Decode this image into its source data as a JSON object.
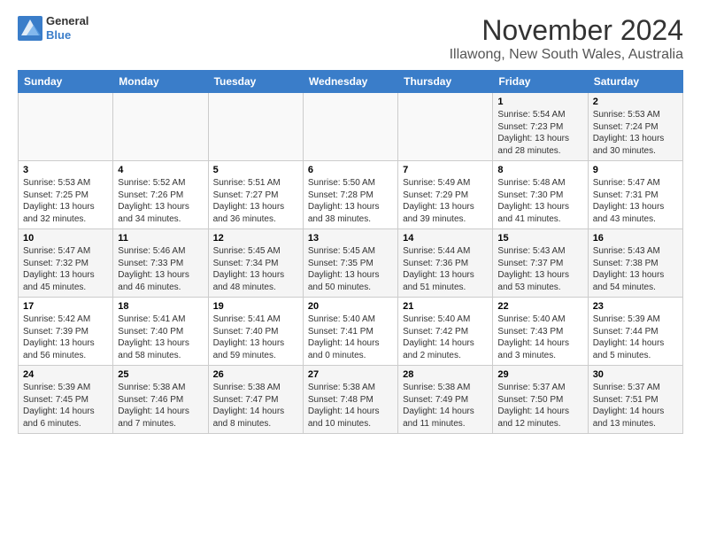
{
  "logo": {
    "line1": "General",
    "line2": "Blue"
  },
  "title": "November 2024",
  "location": "Illawong, New South Wales, Australia",
  "weekdays": [
    "Sunday",
    "Monday",
    "Tuesday",
    "Wednesday",
    "Thursday",
    "Friday",
    "Saturday"
  ],
  "weeks": [
    [
      {
        "day": "",
        "content": ""
      },
      {
        "day": "",
        "content": ""
      },
      {
        "day": "",
        "content": ""
      },
      {
        "day": "",
        "content": ""
      },
      {
        "day": "",
        "content": ""
      },
      {
        "day": "1",
        "content": "Sunrise: 5:54 AM\nSunset: 7:23 PM\nDaylight: 13 hours\nand 28 minutes."
      },
      {
        "day": "2",
        "content": "Sunrise: 5:53 AM\nSunset: 7:24 PM\nDaylight: 13 hours\nand 30 minutes."
      }
    ],
    [
      {
        "day": "3",
        "content": "Sunrise: 5:53 AM\nSunset: 7:25 PM\nDaylight: 13 hours\nand 32 minutes."
      },
      {
        "day": "4",
        "content": "Sunrise: 5:52 AM\nSunset: 7:26 PM\nDaylight: 13 hours\nand 34 minutes."
      },
      {
        "day": "5",
        "content": "Sunrise: 5:51 AM\nSunset: 7:27 PM\nDaylight: 13 hours\nand 36 minutes."
      },
      {
        "day": "6",
        "content": "Sunrise: 5:50 AM\nSunset: 7:28 PM\nDaylight: 13 hours\nand 38 minutes."
      },
      {
        "day": "7",
        "content": "Sunrise: 5:49 AM\nSunset: 7:29 PM\nDaylight: 13 hours\nand 39 minutes."
      },
      {
        "day": "8",
        "content": "Sunrise: 5:48 AM\nSunset: 7:30 PM\nDaylight: 13 hours\nand 41 minutes."
      },
      {
        "day": "9",
        "content": "Sunrise: 5:47 AM\nSunset: 7:31 PM\nDaylight: 13 hours\nand 43 minutes."
      }
    ],
    [
      {
        "day": "10",
        "content": "Sunrise: 5:47 AM\nSunset: 7:32 PM\nDaylight: 13 hours\nand 45 minutes."
      },
      {
        "day": "11",
        "content": "Sunrise: 5:46 AM\nSunset: 7:33 PM\nDaylight: 13 hours\nand 46 minutes."
      },
      {
        "day": "12",
        "content": "Sunrise: 5:45 AM\nSunset: 7:34 PM\nDaylight: 13 hours\nand 48 minutes."
      },
      {
        "day": "13",
        "content": "Sunrise: 5:45 AM\nSunset: 7:35 PM\nDaylight: 13 hours\nand 50 minutes."
      },
      {
        "day": "14",
        "content": "Sunrise: 5:44 AM\nSunset: 7:36 PM\nDaylight: 13 hours\nand 51 minutes."
      },
      {
        "day": "15",
        "content": "Sunrise: 5:43 AM\nSunset: 7:37 PM\nDaylight: 13 hours\nand 53 minutes."
      },
      {
        "day": "16",
        "content": "Sunrise: 5:43 AM\nSunset: 7:38 PM\nDaylight: 13 hours\nand 54 minutes."
      }
    ],
    [
      {
        "day": "17",
        "content": "Sunrise: 5:42 AM\nSunset: 7:39 PM\nDaylight: 13 hours\nand 56 minutes."
      },
      {
        "day": "18",
        "content": "Sunrise: 5:41 AM\nSunset: 7:40 PM\nDaylight: 13 hours\nand 58 minutes."
      },
      {
        "day": "19",
        "content": "Sunrise: 5:41 AM\nSunset: 7:40 PM\nDaylight: 13 hours\nand 59 minutes."
      },
      {
        "day": "20",
        "content": "Sunrise: 5:40 AM\nSunset: 7:41 PM\nDaylight: 14 hours\nand 0 minutes."
      },
      {
        "day": "21",
        "content": "Sunrise: 5:40 AM\nSunset: 7:42 PM\nDaylight: 14 hours\nand 2 minutes."
      },
      {
        "day": "22",
        "content": "Sunrise: 5:40 AM\nSunset: 7:43 PM\nDaylight: 14 hours\nand 3 minutes."
      },
      {
        "day": "23",
        "content": "Sunrise: 5:39 AM\nSunset: 7:44 PM\nDaylight: 14 hours\nand 5 minutes."
      }
    ],
    [
      {
        "day": "24",
        "content": "Sunrise: 5:39 AM\nSunset: 7:45 PM\nDaylight: 14 hours\nand 6 minutes."
      },
      {
        "day": "25",
        "content": "Sunrise: 5:38 AM\nSunset: 7:46 PM\nDaylight: 14 hours\nand 7 minutes."
      },
      {
        "day": "26",
        "content": "Sunrise: 5:38 AM\nSunset: 7:47 PM\nDaylight: 14 hours\nand 8 minutes."
      },
      {
        "day": "27",
        "content": "Sunrise: 5:38 AM\nSunset: 7:48 PM\nDaylight: 14 hours\nand 10 minutes."
      },
      {
        "day": "28",
        "content": "Sunrise: 5:38 AM\nSunset: 7:49 PM\nDaylight: 14 hours\nand 11 minutes."
      },
      {
        "day": "29",
        "content": "Sunrise: 5:37 AM\nSunset: 7:50 PM\nDaylight: 14 hours\nand 12 minutes."
      },
      {
        "day": "30",
        "content": "Sunrise: 5:37 AM\nSunset: 7:51 PM\nDaylight: 14 hours\nand 13 minutes."
      }
    ]
  ]
}
